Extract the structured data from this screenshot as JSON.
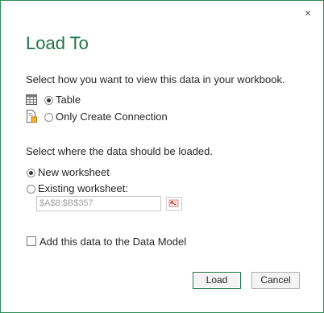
{
  "dialog": {
    "title": "Load To",
    "close_glyph": "×"
  },
  "view_section": {
    "prompt": "Select how you want to view this data in your workbook.",
    "options": [
      {
        "label": "Table",
        "icon": "table-icon",
        "selected": true
      },
      {
        "label": "Only Create Connection",
        "icon": "connection-icon",
        "selected": false
      }
    ]
  },
  "location_section": {
    "prompt": "Select where the data should be loaded.",
    "options": [
      {
        "label": "New worksheet",
        "selected": true
      },
      {
        "label": "Existing worksheet:",
        "selected": false
      }
    ],
    "range_value": "$A$8:$B$357"
  },
  "data_model": {
    "label": "Add this data to the Data Model",
    "checked": false
  },
  "buttons": {
    "load": "Load",
    "cancel": "Cancel"
  },
  "colors": {
    "accent": "#217346",
    "border": "#2e8b57"
  }
}
